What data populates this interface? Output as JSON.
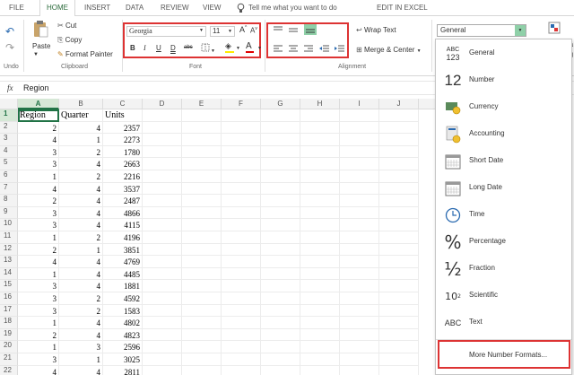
{
  "tabs": [
    {
      "label": "FILE",
      "active": false
    },
    {
      "label": "HOME",
      "active": true
    },
    {
      "label": "INSERT",
      "active": false
    },
    {
      "label": "DATA",
      "active": false
    },
    {
      "label": "REVIEW",
      "active": false
    },
    {
      "label": "VIEW",
      "active": false
    }
  ],
  "tell_me": "Tell me what you want to do",
  "edit_in_excel": "EDIT IN EXCEL",
  "ribbon": {
    "undo_label": "Undo",
    "paste": "Paste",
    "cut": "Cut",
    "copy": "Copy",
    "format_painter": "Format Painter",
    "clipboard_group": "Clipboard",
    "font_name": "Georgia",
    "font_size": "11",
    "font_group": "Font",
    "wrap_text": "Wrap Text",
    "merge_center": "Merge & Center",
    "alignment_group": "Alignment",
    "number_format": "General",
    "right_partial_1": "iona",
    "right_partial_2": "tting"
  },
  "formula_bar": {
    "fx": "fx",
    "value": "Region"
  },
  "columns": [
    "A",
    "B",
    "C",
    "D",
    "E",
    "F",
    "G",
    "H",
    "I",
    "J"
  ],
  "header_row": {
    "row": "1",
    "cells": [
      "Region",
      "Quarter",
      "Units"
    ]
  },
  "rows": [
    {
      "row": "2",
      "cells": [
        "2",
        "4",
        "2357"
      ]
    },
    {
      "row": "3",
      "cells": [
        "4",
        "1",
        "2273"
      ]
    },
    {
      "row": "4",
      "cells": [
        "3",
        "2",
        "1780"
      ]
    },
    {
      "row": "5",
      "cells": [
        "3",
        "4",
        "2663"
      ]
    },
    {
      "row": "6",
      "cells": [
        "1",
        "2",
        "2216"
      ]
    },
    {
      "row": "7",
      "cells": [
        "4",
        "4",
        "3537"
      ]
    },
    {
      "row": "8",
      "cells": [
        "2",
        "4",
        "2487"
      ]
    },
    {
      "row": "9",
      "cells": [
        "3",
        "4",
        "4866"
      ]
    },
    {
      "row": "10",
      "cells": [
        "3",
        "4",
        "4115"
      ]
    },
    {
      "row": "11",
      "cells": [
        "1",
        "2",
        "4196"
      ]
    },
    {
      "row": "12",
      "cells": [
        "2",
        "1",
        "3851"
      ]
    },
    {
      "row": "13",
      "cells": [
        "4",
        "4",
        "4769"
      ]
    },
    {
      "row": "14",
      "cells": [
        "1",
        "4",
        "4485"
      ]
    },
    {
      "row": "15",
      "cells": [
        "3",
        "4",
        "1881"
      ]
    },
    {
      "row": "16",
      "cells": [
        "3",
        "2",
        "4592"
      ]
    },
    {
      "row": "17",
      "cells": [
        "3",
        "2",
        "1583"
      ]
    },
    {
      "row": "18",
      "cells": [
        "1",
        "4",
        "4802"
      ]
    },
    {
      "row": "19",
      "cells": [
        "2",
        "4",
        "4823"
      ]
    },
    {
      "row": "20",
      "cells": [
        "1",
        "3",
        "2596"
      ]
    },
    {
      "row": "21",
      "cells": [
        "3",
        "1",
        "3025"
      ]
    },
    {
      "row": "22",
      "cells": [
        "4",
        "4",
        "2811"
      ]
    }
  ],
  "number_formats": [
    {
      "label": "General",
      "icon": "general-icon",
      "glyph": "ABC\n123"
    },
    {
      "label": "Number",
      "icon": "number-icon",
      "glyph": "12"
    },
    {
      "label": "Currency",
      "icon": "currency-icon",
      "glyph": ""
    },
    {
      "label": "Accounting",
      "icon": "accounting-icon",
      "glyph": ""
    },
    {
      "label": "Short Date",
      "icon": "short-date-icon",
      "glyph": ""
    },
    {
      "label": "Long Date",
      "icon": "long-date-icon",
      "glyph": ""
    },
    {
      "label": "Time",
      "icon": "time-icon",
      "glyph": ""
    },
    {
      "label": "Percentage",
      "icon": "percentage-icon",
      "glyph": "%"
    },
    {
      "label": "Fraction",
      "icon": "fraction-icon",
      "glyph": "½"
    },
    {
      "label": "Scientific",
      "icon": "scientific-icon",
      "glyph": "10²"
    },
    {
      "label": "Text",
      "icon": "text-icon",
      "glyph": "ABC"
    }
  ],
  "more_formats": "More Number Formats...",
  "colors": {
    "accent": "#217346",
    "highlight_box": "#d33333",
    "selected_align": "#8fd0a8"
  }
}
